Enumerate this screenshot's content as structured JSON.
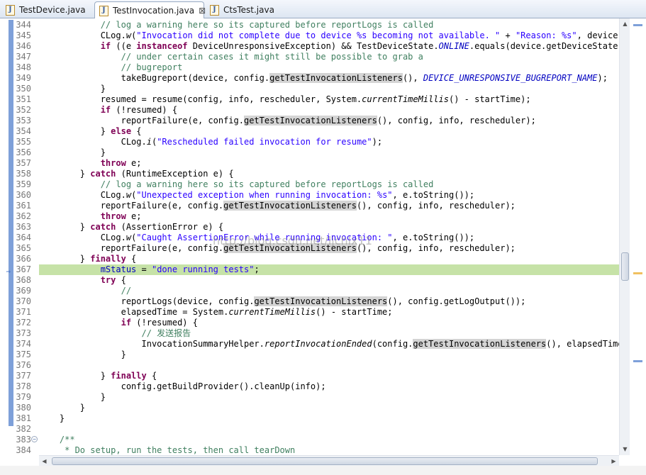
{
  "tabs": [
    {
      "label": "TestDevice.java"
    },
    {
      "label": "TestInvocation.java",
      "close": "⊠"
    },
    {
      "label": "CtsTest.java"
    }
  ],
  "file_icon_letter": "J",
  "watermark": "http://blog.csdn.net/ljchlx11",
  "lines": [
    {
      "n": "344",
      "tokens": [
        [
          "            ",
          ""
        ],
        [
          "// log a warning here so its captured before reportLogs is called",
          "c"
        ]
      ]
    },
    {
      "n": "345",
      "tokens": [
        [
          "            CLog.",
          ""
        ],
        [
          "w",
          "i"
        ],
        [
          "(",
          ""
        ],
        [
          "\"Invocation did not complete due to device %s becoming not available. \"",
          "s"
        ],
        [
          " + ",
          ""
        ],
        [
          "\"Reason: %s\"",
          "s"
        ],
        [
          ", device.getSerialNumber(),",
          ""
        ]
      ]
    },
    {
      "n": "346",
      "tokens": [
        [
          "            ",
          ""
        ],
        [
          "if",
          "k"
        ],
        [
          " ((e ",
          ""
        ],
        [
          "instanceof",
          "k"
        ],
        [
          " DeviceUnresponsiveException) && TestDeviceState.",
          ""
        ],
        [
          "ONLINE",
          "f"
        ],
        [
          ".equals(device.getDeviceState())) {",
          ""
        ]
      ]
    },
    {
      "n": "347",
      "tokens": [
        [
          "                ",
          ""
        ],
        [
          "// under certain cases it might still be possible to grab a",
          "c"
        ]
      ]
    },
    {
      "n": "348",
      "tokens": [
        [
          "                ",
          ""
        ],
        [
          "// bugreport",
          "c"
        ]
      ]
    },
    {
      "n": "349",
      "tokens": [
        [
          "                takeBugreport(device, config.",
          ""
        ],
        [
          "getTestInvocationListeners",
          "occ"
        ],
        [
          "(), ",
          ""
        ],
        [
          "DEVICE_UNRESPONSIVE_BUGREPORT_NAME",
          "f"
        ],
        [
          ");",
          ""
        ]
      ]
    },
    {
      "n": "350",
      "tokens": [
        [
          "            }",
          ""
        ]
      ]
    },
    {
      "n": "351",
      "tokens": [
        [
          "            resumed = resume(config, info, rescheduler, System.",
          ""
        ],
        [
          "currentTimeMillis",
          "i"
        ],
        [
          "() - startTime);",
          ""
        ]
      ]
    },
    {
      "n": "352",
      "tokens": [
        [
          "            ",
          ""
        ],
        [
          "if",
          "k"
        ],
        [
          " (!resumed) {",
          ""
        ]
      ]
    },
    {
      "n": "353",
      "tokens": [
        [
          "                reportFailure(e, config.",
          ""
        ],
        [
          "getTestInvocationListeners",
          "occ"
        ],
        [
          "(), config, info, rescheduler);",
          ""
        ]
      ]
    },
    {
      "n": "354",
      "tokens": [
        [
          "            } ",
          ""
        ],
        [
          "else",
          "k"
        ],
        [
          " {",
          ""
        ]
      ]
    },
    {
      "n": "355",
      "tokens": [
        [
          "                CLog.",
          ""
        ],
        [
          "i",
          "i"
        ],
        [
          "(",
          ""
        ],
        [
          "\"Rescheduled failed invocation for resume\"",
          "s"
        ],
        [
          ");",
          ""
        ]
      ]
    },
    {
      "n": "356",
      "tokens": [
        [
          "            }",
          ""
        ]
      ]
    },
    {
      "n": "357",
      "tokens": [
        [
          "            ",
          ""
        ],
        [
          "throw",
          "k"
        ],
        [
          " e;",
          ""
        ]
      ]
    },
    {
      "n": "358",
      "tokens": [
        [
          "        } ",
          ""
        ],
        [
          "catch",
          "k"
        ],
        [
          " (RuntimeException e) {",
          ""
        ]
      ]
    },
    {
      "n": "359",
      "tokens": [
        [
          "            ",
          ""
        ],
        [
          "// log a warning here so its captured before reportLogs is called",
          "c"
        ]
      ]
    },
    {
      "n": "360",
      "tokens": [
        [
          "            CLog.",
          ""
        ],
        [
          "w",
          "i"
        ],
        [
          "(",
          ""
        ],
        [
          "\"Unexpected exception when running invocation: %s\"",
          "s"
        ],
        [
          ", e.toString());",
          ""
        ]
      ]
    },
    {
      "n": "361",
      "tokens": [
        [
          "            reportFailure(e, config.",
          ""
        ],
        [
          "getTestInvocationListeners",
          "occ"
        ],
        [
          "(), config, info, rescheduler);",
          ""
        ]
      ]
    },
    {
      "n": "362",
      "tokens": [
        [
          "            ",
          ""
        ],
        [
          "throw",
          "k"
        ],
        [
          " e;",
          ""
        ]
      ]
    },
    {
      "n": "363",
      "tokens": [
        [
          "        } ",
          ""
        ],
        [
          "catch",
          "k"
        ],
        [
          " (AssertionError e) {",
          ""
        ]
      ]
    },
    {
      "n": "364",
      "tokens": [
        [
          "            CLog.",
          ""
        ],
        [
          "w",
          "i"
        ],
        [
          "(",
          ""
        ],
        [
          "\"Caught AssertionError while running invocation: \"",
          "s"
        ],
        [
          ", e.toString());",
          ""
        ]
      ]
    },
    {
      "n": "365",
      "tokens": [
        [
          "            reportFailure(e, config.",
          ""
        ],
        [
          "getTestInvocationListeners",
          "occ"
        ],
        [
          "(), config, info, rescheduler);",
          ""
        ]
      ]
    },
    {
      "n": "366",
      "tokens": [
        [
          "        } ",
          ""
        ],
        [
          "finally",
          "k"
        ],
        [
          " {",
          ""
        ]
      ]
    },
    {
      "n": "367",
      "tokens": [
        [
          "            ",
          ""
        ],
        [
          "mStatus",
          "fb"
        ],
        [
          " = ",
          ""
        ],
        [
          "\"done running tests\"",
          "s"
        ],
        [
          ";",
          ""
        ]
      ]
    },
    {
      "n": "368",
      "tokens": [
        [
          "            ",
          ""
        ],
        [
          "try",
          "k"
        ],
        [
          " {",
          ""
        ]
      ]
    },
    {
      "n": "369",
      "tokens": [
        [
          "                ",
          ""
        ],
        [
          "//",
          "c"
        ]
      ]
    },
    {
      "n": "370",
      "tokens": [
        [
          "                reportLogs(device, config.",
          ""
        ],
        [
          "getTestInvocationListeners",
          "occ"
        ],
        [
          "(), config.getLogOutput());",
          ""
        ]
      ]
    },
    {
      "n": "371",
      "tokens": [
        [
          "                elapsedTime = System.",
          ""
        ],
        [
          "currentTimeMillis",
          "i"
        ],
        [
          "() - startTime;",
          ""
        ]
      ]
    },
    {
      "n": "372",
      "tokens": [
        [
          "                ",
          ""
        ],
        [
          "if",
          "k"
        ],
        [
          " (!resumed) {",
          ""
        ]
      ]
    },
    {
      "n": "373",
      "tokens": [
        [
          "                    ",
          ""
        ],
        [
          "// 发送报告",
          "c"
        ]
      ]
    },
    {
      "n": "374",
      "tokens": [
        [
          "                    InvocationSummaryHelper.",
          ""
        ],
        [
          "reportInvocationEnded",
          "i"
        ],
        [
          "(config.",
          ""
        ],
        [
          "getTestInvocationListeners",
          "occ"
        ],
        [
          "(), elapsedTime);",
          ""
        ]
      ]
    },
    {
      "n": "375",
      "tokens": [
        [
          "                }",
          ""
        ]
      ]
    },
    {
      "n": "376",
      "tokens": [
        [
          "",
          ""
        ]
      ]
    },
    {
      "n": "377",
      "tokens": [
        [
          "            } ",
          ""
        ],
        [
          "finally",
          "k"
        ],
        [
          " {",
          ""
        ]
      ]
    },
    {
      "n": "378",
      "tokens": [
        [
          "                config.getBuildProvider().cleanUp(info);",
          ""
        ]
      ]
    },
    {
      "n": "379",
      "tokens": [
        [
          "            }",
          ""
        ]
      ]
    },
    {
      "n": "380",
      "tokens": [
        [
          "        }",
          ""
        ]
      ]
    },
    {
      "n": "381",
      "tokens": [
        [
          "    }",
          ""
        ]
      ]
    },
    {
      "n": "382",
      "tokens": [
        [
          "",
          ""
        ]
      ]
    },
    {
      "n": "383",
      "tokens": [
        [
          "    ",
          ""
        ],
        [
          "/**",
          "c"
        ]
      ]
    },
    {
      "n": "384",
      "tokens": [
        [
          "     ",
          ""
        ],
        [
          "* Do setup, run the tests, then call tearDown",
          "c"
        ]
      ]
    }
  ],
  "current_line": "367",
  "fold_lines": [
    "383"
  ]
}
